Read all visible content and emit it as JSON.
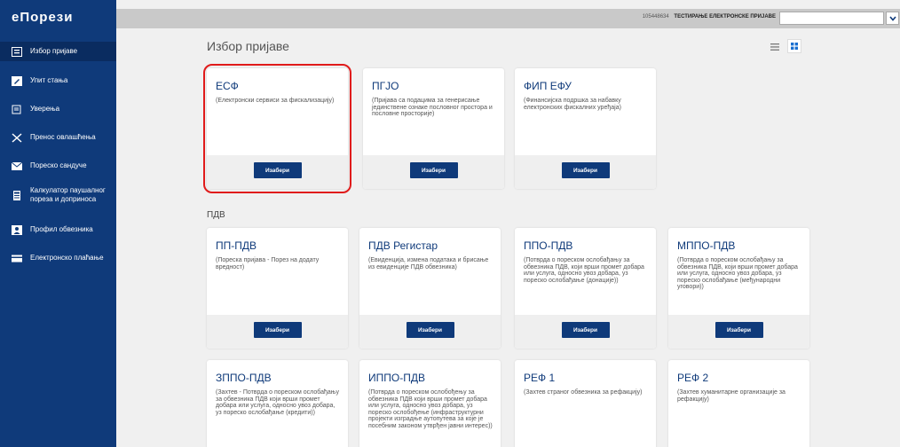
{
  "app": {
    "logo": "еПорези"
  },
  "sidebar": {
    "items": [
      {
        "label": "Избор пријаве"
      },
      {
        "label": "Упит стања"
      },
      {
        "label": "Уверења"
      },
      {
        "label": "Пренос овлашћења"
      },
      {
        "label": "Пореско сандуче"
      },
      {
        "label": "Калкулатор паушалног пореза и доприноса"
      },
      {
        "label": "Профил обвезника"
      },
      {
        "label": "Електронско плаћање"
      }
    ]
  },
  "topbar": {
    "user_id": "105448634",
    "user_name": "ТЕСТИРАЊЕ ЕЛЕКТРОНСКЕ ПРИЈАВЕ"
  },
  "main": {
    "title": "Избор пријаве",
    "section_pdv": "ПДВ",
    "cards": [
      {
        "title": "ЕСФ",
        "desc": "(Електронски сервиси за фискализацију)",
        "button": "Изабери"
      },
      {
        "title": "ПГЈО",
        "desc": "(Пријава са подацима за генерисање јединствене ознаке пословног простора и пословне просторије)",
        "button": "Изабери"
      },
      {
        "title": "ФИП ЕФУ",
        "desc": "(Финансијска подршка за набавку електронских фискалних уређаја)",
        "button": "Изабери"
      },
      {
        "title": "ПП-ПДВ",
        "desc": "(Пореска пријава - Порез на додату вредност)",
        "button": "Изабери"
      },
      {
        "title": "ПДВ Регистар",
        "desc": "(Евиденција, измена података и брисање из евиденције ПДВ обвезника)",
        "button": "Изабери"
      },
      {
        "title": "ППО-ПДВ",
        "desc": "(Потврда о пореском ослобађању за обвезника ПДВ, који врши промет добара или услуга, односно увоз добара, уз пореско ослобађање (донације))",
        "button": "Изабери"
      },
      {
        "title": "МППО-ПДВ",
        "desc": "(Потврда о пореском ослобађању за обвезника ПДВ, који врши промет добара или услуга, односно увоз добара, уз пореско ослобађање (међународни уговори))",
        "button": "Изабери"
      },
      {
        "title": "ЗППО-ПДВ",
        "desc": "(Захтев - Потврда о пореском ослобађању за обвезника ПДВ који врши промет добара или услуга, односно увоз добара, уз пореско ослобађање (кредити))",
        "button": ""
      },
      {
        "title": "ИППО-ПДВ",
        "desc": "(Потврда о пореском ослобођењу за обвезника ПДВ који врши промет добара или услуга, односно увоз добара, уз пореско ослобођење (инфраструктурни пројекти изградње аутопутева за које је посебним законом утврђен јавни интерес))",
        "button": ""
      },
      {
        "title": "РЕФ 1",
        "desc": "(Захтев страног обвезника за рефакцију)",
        "button": ""
      },
      {
        "title": "РЕФ 2",
        "desc": "(Захтев хуманитарне организације за рефакцију)",
        "button": ""
      }
    ]
  },
  "colors": {
    "sidebar": "#0f3a7a",
    "accent": "#0f3a7a",
    "highlight": "#e01b1b"
  }
}
